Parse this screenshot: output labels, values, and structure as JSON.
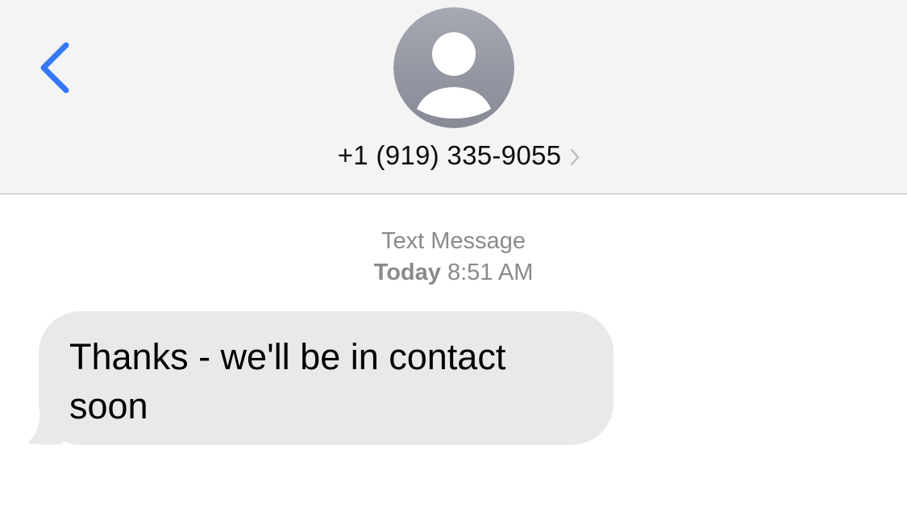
{
  "header": {
    "back_icon": "chevron-left-icon",
    "avatar_icon": "person-silhouette-icon",
    "contact": "+1 (919) 335-9055",
    "contact_chevron_icon": "chevron-right-icon"
  },
  "thread": {
    "service": "Text Message",
    "timestamp_day": "Today",
    "timestamp_time": "8:51 AM"
  },
  "messages": [
    {
      "direction": "incoming",
      "text": "Thanks - we'll be in contact soon"
    }
  ],
  "colors": {
    "accent": "#3478f6",
    "header_bg": "#f4f4f4",
    "incoming_bubble": "#e9e9eb",
    "meta_text": "#8a8a8e"
  }
}
